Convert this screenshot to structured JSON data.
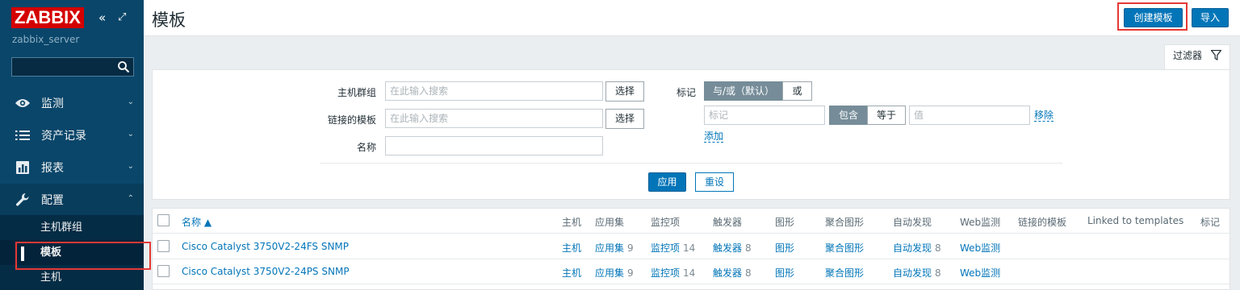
{
  "sidebar": {
    "logo": "ZABBIX",
    "collapse_glyph": "«",
    "expand_glyph": "⤢",
    "server": "zabbix_server",
    "search_value": "",
    "menu": [
      {
        "label": "监测",
        "icon": "eye-icon",
        "chevron": "⌄"
      },
      {
        "label": "资产记录",
        "icon": "list-icon",
        "chevron": "⌄"
      },
      {
        "label": "报表",
        "icon": "bar-chart-icon",
        "chevron": "⌄"
      },
      {
        "label": "配置",
        "icon": "wrench-icon",
        "chevron": "⌃"
      }
    ],
    "submenu": [
      "主机群组",
      "模板",
      "主机"
    ]
  },
  "header": {
    "title": "模板",
    "create_label": "创建模板",
    "import_label": "导入"
  },
  "filter": {
    "tab_label": "过滤器",
    "host_group_label": "主机群组",
    "host_group_placeholder": "在此输入搜索",
    "linked_label": "链接的模板",
    "linked_placeholder": "在此输入搜索",
    "name_label": "名称",
    "name_value": "",
    "select_label": "选择",
    "tags_label": "标记",
    "and_or_label": "与/或（默认）",
    "or_label": "或",
    "tag_placeholder": "标记",
    "contains_label": "包含",
    "equals_label": "等于",
    "value_placeholder": "值",
    "remove_label": "移除",
    "add_label": "添加",
    "apply_label": "应用",
    "reset_label": "重设"
  },
  "table": {
    "headers": {
      "name": "名称 ▲",
      "hosts": "主机",
      "apps": "应用集",
      "items": "监控项",
      "triggers": "触发器",
      "graphs": "图形",
      "screens": "聚合图形",
      "discovery": "自动发现",
      "web": "Web监测",
      "linked": "链接的模板",
      "linked_to": "Linked to templates",
      "tags": "标记"
    },
    "rows": [
      {
        "name": "Cisco Catalyst 3750V2-24FS SNMP",
        "hosts": "主机",
        "apps": "应用集",
        "apps_count": "9",
        "items": "监控项",
        "items_count": "14",
        "triggers": "触发器",
        "triggers_count": "8",
        "graphs": "图形",
        "screens": "聚合图形",
        "discovery": "自动发现",
        "discovery_count": "8",
        "web": "Web监测"
      },
      {
        "name": "Cisco Catalyst 3750V2-24PS SNMP",
        "hosts": "主机",
        "apps": "应用集",
        "apps_count": "9",
        "items": "监控项",
        "items_count": "14",
        "triggers": "触发器",
        "triggers_count": "8",
        "graphs": "图形",
        "screens": "聚合图形",
        "discovery": "自动发现",
        "discovery_count": "8",
        "web": "Web监测"
      }
    ]
  },
  "colors": {
    "sidebar": "#0a466a",
    "accent": "#0275b8",
    "highlight": "#e53935",
    "logo": "#d40000"
  }
}
